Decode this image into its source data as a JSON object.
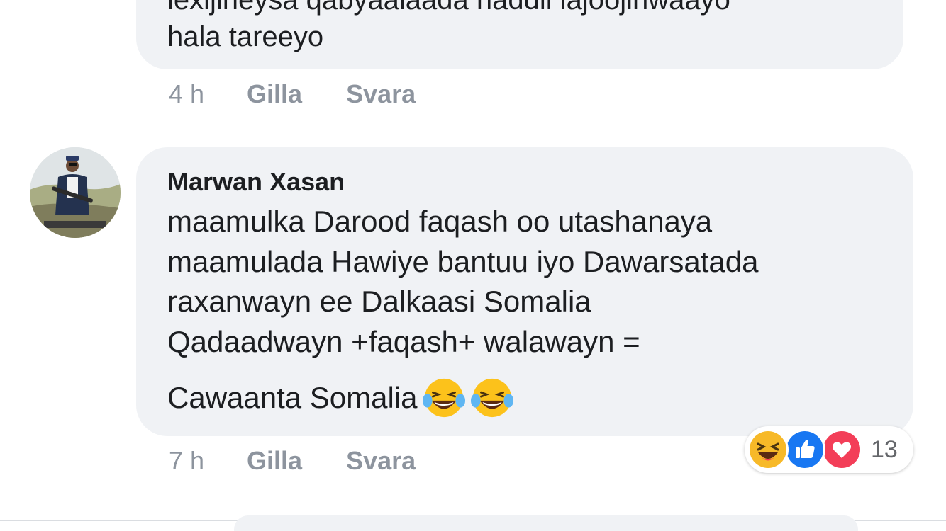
{
  "comments": [
    {
      "body_lines": [
        "lexijineysa qabyaalaada haddii lajoojinwaayo",
        "hala tareeyo"
      ],
      "time": "4 h",
      "like_label": "Gilla",
      "reply_label": "Svara"
    },
    {
      "author": "Marwan Xasan",
      "body_lines": [
        "maamulka Darood faqash oo utashanaya",
        "maamulada Hawiye bantuu iyo Dawarsatada",
        "raxanwayn ee Dalkaasi Somalia",
        "Qadaadwayn +faqash+ walawayn =",
        "Cawaanta Somalia"
      ],
      "emoji": [
        "laughing-tears-emoji",
        "laughing-tears-emoji"
      ],
      "time": "7 h",
      "like_label": "Gilla",
      "reply_label": "Svara",
      "reactions": {
        "icons": [
          "haha-icon",
          "like-icon",
          "love-icon"
        ],
        "count": "13"
      }
    }
  ],
  "colors": {
    "bubble": "#f0f2f5",
    "meta_text": "#8d949e",
    "like_blue": "#1877f2",
    "love_red": "#f33e58",
    "haha_yellow": "#f7b928"
  }
}
